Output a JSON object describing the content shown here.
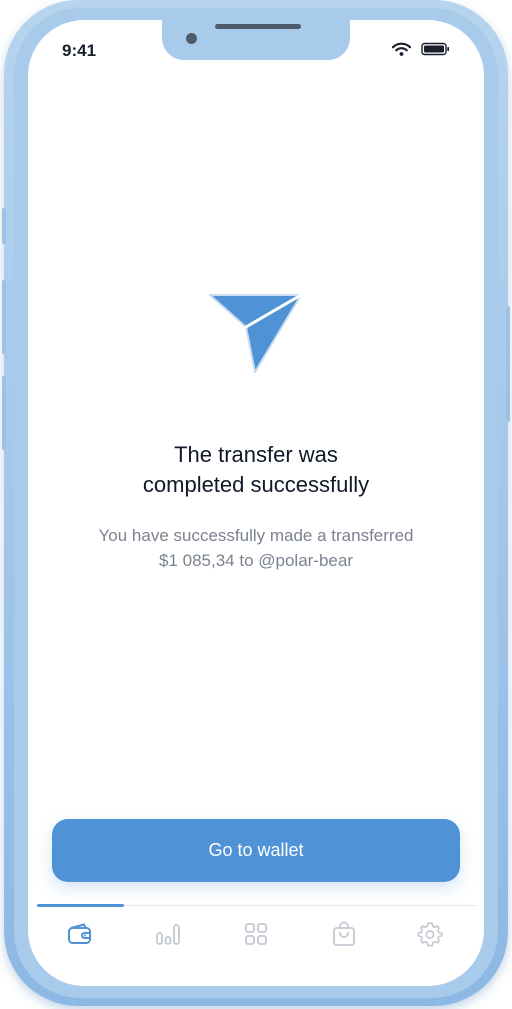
{
  "status_bar": {
    "time": "9:41"
  },
  "success": {
    "title_lines": [
      "The transfer was",
      "completed successfully"
    ],
    "subtitle_lines": [
      "You have successfully made a transferred",
      "$1 085,34 to @polar-bear"
    ]
  },
  "actions": {
    "primary_label": "Go to wallet"
  },
  "tabbar": {
    "items": [
      {
        "icon": "wallet-icon",
        "active": true
      },
      {
        "icon": "chart-icon",
        "active": false
      },
      {
        "icon": "grid-icon",
        "active": false
      },
      {
        "icon": "shopping-bag-icon",
        "active": false
      },
      {
        "icon": "gear-icon",
        "active": false
      }
    ]
  },
  "colors": {
    "accent": "#4f93d6",
    "title": "#111827",
    "muted": "#7b8390",
    "inactive_icon": "#c3c9d2",
    "frame": "#a9cbeb"
  }
}
